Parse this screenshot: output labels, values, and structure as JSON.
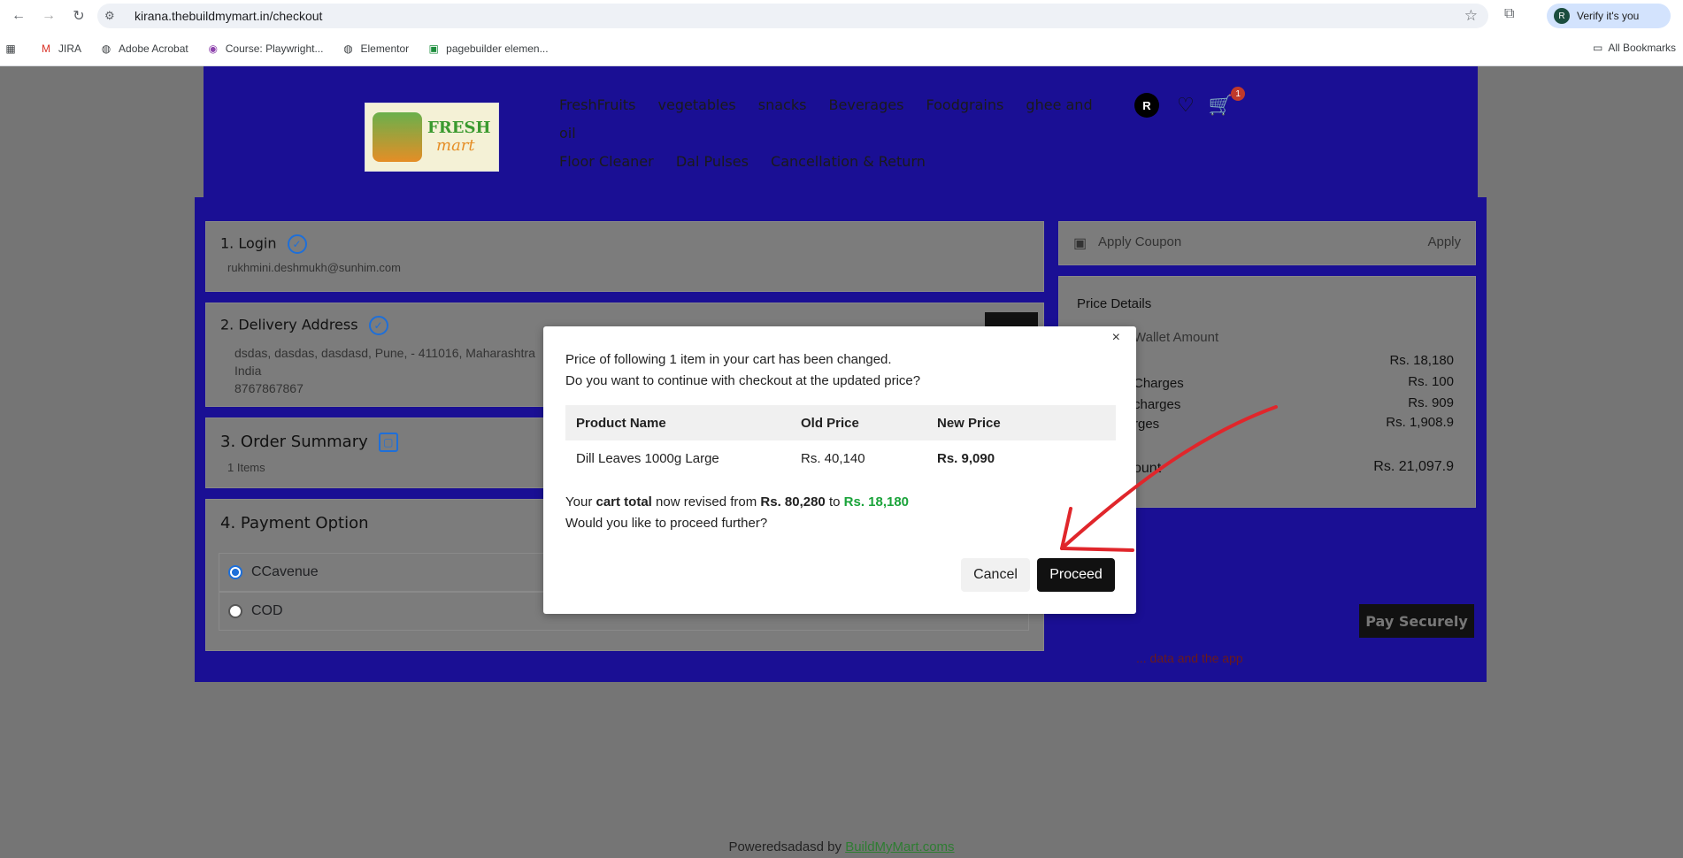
{
  "browser": {
    "url": "kirana.thebuildmymart.in/checkout",
    "verify_label": "Verify it's you",
    "verify_avatar": "R",
    "bookmarks": [
      "JIRA",
      "Adobe Acrobat",
      "Course: Playwright...",
      "Elementor",
      "pagebuilder elemen..."
    ],
    "all_bookmarks": "All Bookmarks"
  },
  "header": {
    "logo_line1": "FRESH",
    "logo_line2": "mart",
    "menu": [
      "FreshFruits",
      "vegetables",
      "snacks",
      "Beverages",
      "Foodgrains",
      "ghee and oil",
      "Floor Cleaner",
      "Dal Pulses",
      "Cancellation & Return"
    ],
    "user_initial": "R",
    "cart_count": "1"
  },
  "checkout": {
    "login_title": "1. Login",
    "login_email": "rukhmini.deshmukh@sunhim.com",
    "address_title": "2. Delivery Address",
    "address_line1": "dsdas, dasdas, dasdasd, Pune, - 411016, Maharashtra",
    "address_line2": "India",
    "address_phone": "8767867867",
    "order_title": "3. Order Summary",
    "order_items": "1 Items",
    "payment_title": "4. Payment Option",
    "payment_options": [
      "CCavenue",
      "COD"
    ]
  },
  "sidebar": {
    "coupon_label": "Apply Coupon",
    "coupon_apply": "Apply",
    "price_details": "Price Details",
    "wallet": "Wallet Amount",
    "rows": [
      {
        "label": "",
        "value": "Rs. 18,180"
      },
      {
        "label": "Charges",
        "value": "Rs. 100"
      },
      {
        "label": "charges",
        "value": "Rs. 909"
      },
      {
        "label": "rges",
        "value": "Rs. 1,908.9"
      }
    ],
    "total_label": "ount",
    "total_value": "Rs. 21,097.9",
    "pay_button": "Pay Securely",
    "note": "... data and the app"
  },
  "modal": {
    "close": "×",
    "line1": "Price of following 1 item in your cart has been changed.",
    "line2": "Do you want to continue with checkout at the updated price?",
    "headers": [
      "Product Name",
      "Old Price",
      "New Price"
    ],
    "row": {
      "product": "Dill Leaves 1000g Large",
      "old": "Rs. 40,140",
      "new": "Rs. 9,090"
    },
    "total_prefix": "Your ",
    "total_bold": "cart total",
    "total_mid": " now revised from ",
    "total_from": "Rs. 80,280",
    "total_to_word": " to ",
    "total_to": "Rs. 18,180",
    "question": "Would you like to proceed further?",
    "cancel": "Cancel",
    "proceed": "Proceed"
  },
  "footer": {
    "text": "Poweredsadasd by ",
    "link": "BuildMyMart.coms"
  },
  "colors": {
    "header_bg": "#1a0f94",
    "accent_green": "#1aa33a",
    "annotation_red": "#e0262b"
  }
}
